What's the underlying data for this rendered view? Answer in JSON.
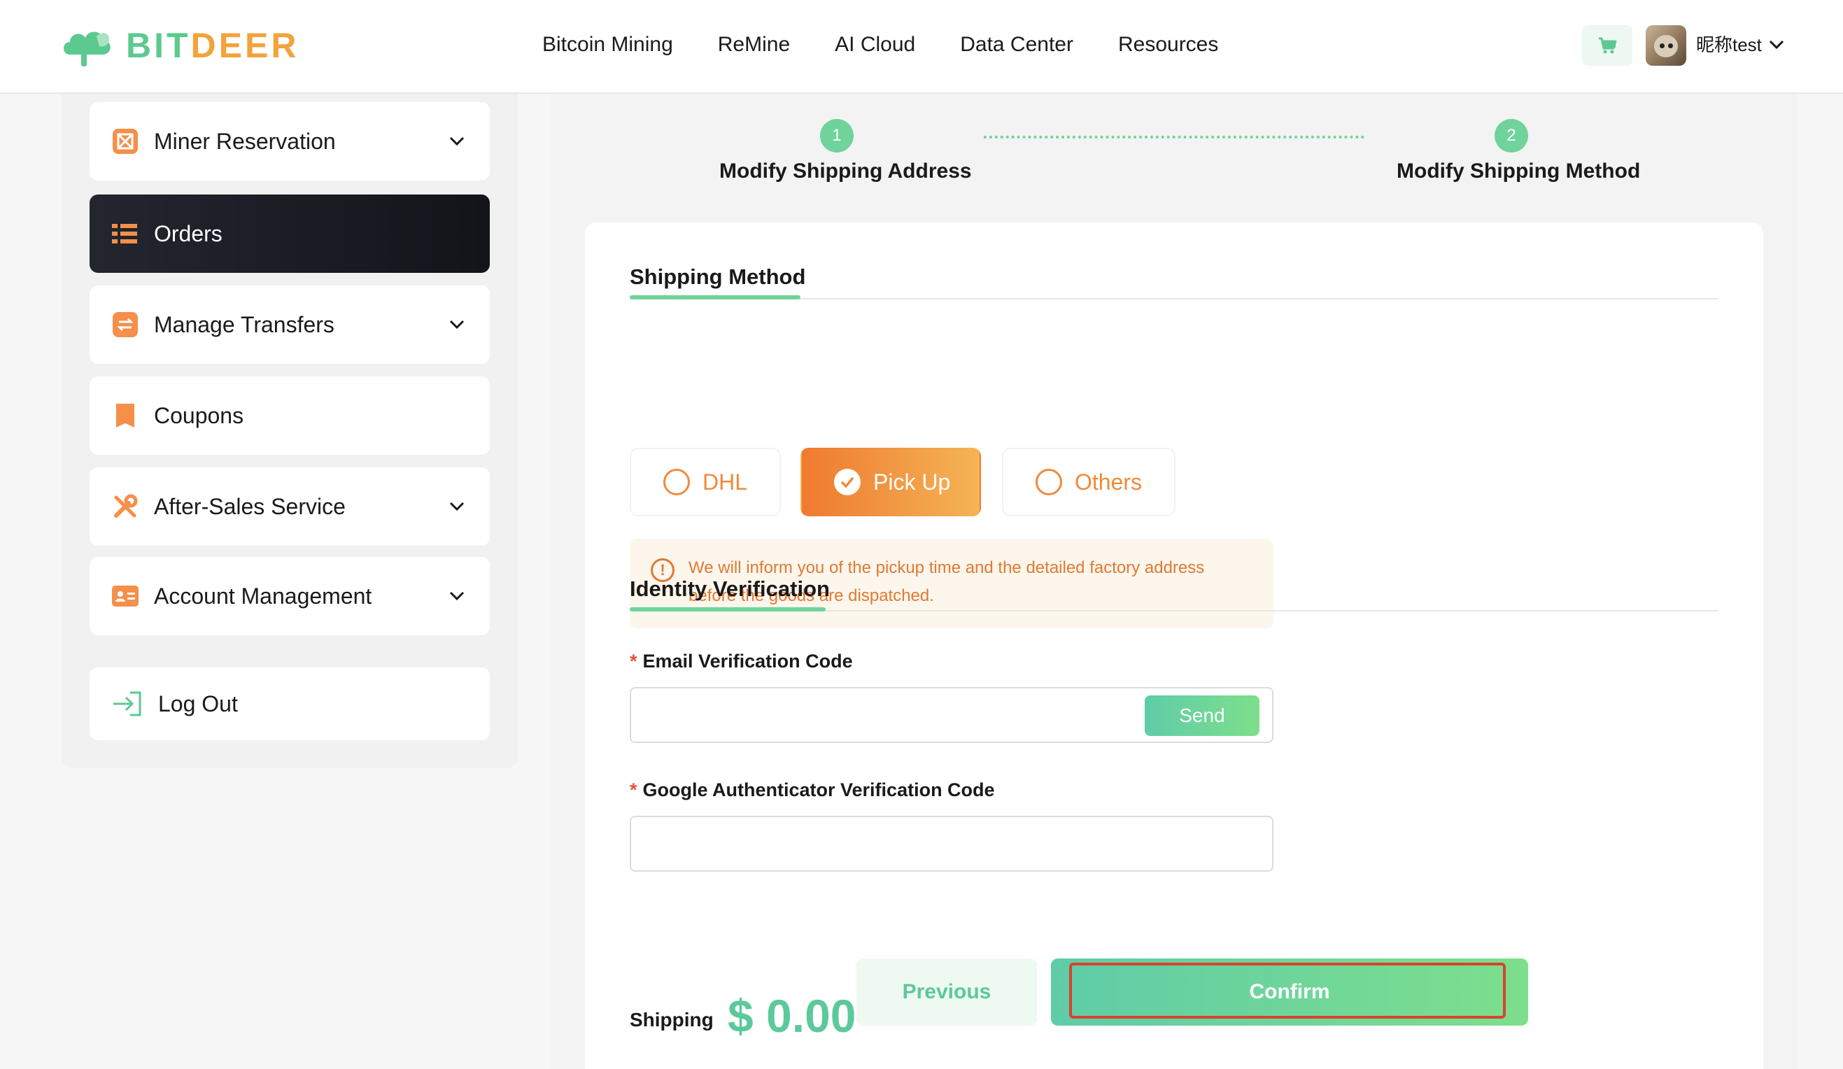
{
  "brand": {
    "name_part1": "BIT",
    "name_part2": "DEER",
    "green": "#5cc98f",
    "orange": "#f2a33c"
  },
  "nav": {
    "items": [
      {
        "label": "Bitcoin Mining"
      },
      {
        "label": "ReMine"
      },
      {
        "label": "AI Cloud"
      },
      {
        "label": "Data Center"
      },
      {
        "label": "Resources"
      }
    ]
  },
  "user": {
    "name": "昵称test",
    "cart_icon": "cart-icon",
    "dropdown_icon": "chevron-down-icon"
  },
  "sidebar": {
    "items": [
      {
        "label": "Miner Reservation",
        "icon": "miner-icon",
        "expandable": true,
        "active": false
      },
      {
        "label": "Orders",
        "icon": "list-icon",
        "expandable": false,
        "active": true
      },
      {
        "label": "Manage Transfers",
        "icon": "transfer-icon",
        "expandable": true,
        "active": false
      },
      {
        "label": "Coupons",
        "icon": "bookmark-icon",
        "expandable": false,
        "active": false
      },
      {
        "label": "After-Sales Service",
        "icon": "tools-icon",
        "expandable": true,
        "active": false
      },
      {
        "label": "Account Management",
        "icon": "id-card-icon",
        "expandable": true,
        "active": false
      }
    ],
    "logout": {
      "label": "Log Out",
      "icon": "logout-icon"
    }
  },
  "steps": [
    {
      "number": "1",
      "label": "Modify Shipping Address"
    },
    {
      "number": "2",
      "label": "Modify Shipping Method"
    }
  ],
  "shipping_method": {
    "title": "Shipping Method",
    "options": [
      {
        "label": "DHL",
        "selected": false
      },
      {
        "label": "Pick Up",
        "selected": true
      },
      {
        "label": "Others",
        "selected": false
      }
    ],
    "notice_line1": "We will inform you of the pickup time and the detailed factory address",
    "notice_line2": "before the goods are dispatched.",
    "notice_icon": "!"
  },
  "identity": {
    "title": "Identity Verification",
    "email_label": "Email Verification Code",
    "email_value": "",
    "send_label": "Send",
    "google_label": "Google Authenticator Verification Code",
    "google_value": "",
    "required_mark": "*"
  },
  "shipping": {
    "label": "Shipping",
    "price": "$ 0.00"
  },
  "actions": {
    "previous_label": "Previous",
    "confirm_label": "Confirm"
  },
  "colors": {
    "accent_green": "#6fd39b",
    "accent_orange": "#ef7a30",
    "highlight_red": "#d8432e"
  }
}
